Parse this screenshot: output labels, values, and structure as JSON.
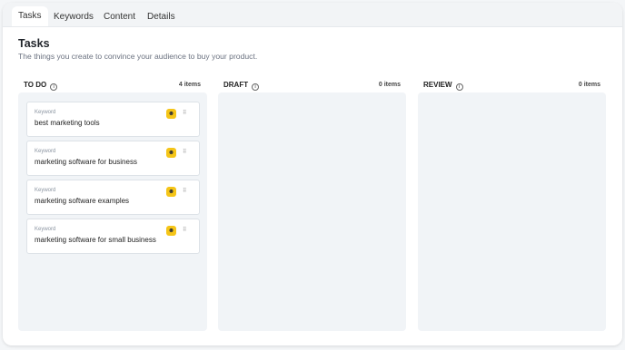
{
  "tabs": [
    {
      "label": "Tasks",
      "active": true
    },
    {
      "label": "Keywords",
      "active": false
    },
    {
      "label": "Content",
      "active": false
    },
    {
      "label": "Details",
      "active": false
    }
  ],
  "header": {
    "title": "Tasks",
    "subtitle": "The things you create to convince your audience to buy your product."
  },
  "columns": [
    {
      "name": "TO DO",
      "count": "4 items",
      "cards": [
        {
          "label": "Keyword",
          "value": "best marketing tools"
        },
        {
          "label": "Keyword",
          "value": "marketing software for business"
        },
        {
          "label": "Keyword",
          "value": "marketing software examples"
        },
        {
          "label": "Keyword",
          "value": "marketing software for small business"
        }
      ]
    },
    {
      "name": "DRAFT",
      "count": "0 items",
      "cards": []
    },
    {
      "name": "REVIEW",
      "count": "0 items",
      "cards": []
    }
  ],
  "icons": {
    "card_badge": "emoji-face-icon",
    "drag_handle": "drag-handle-icon",
    "column_info": "info-icon"
  },
  "colors": {
    "badge": "#f5c518",
    "column_bg": "#f1f4f7"
  }
}
